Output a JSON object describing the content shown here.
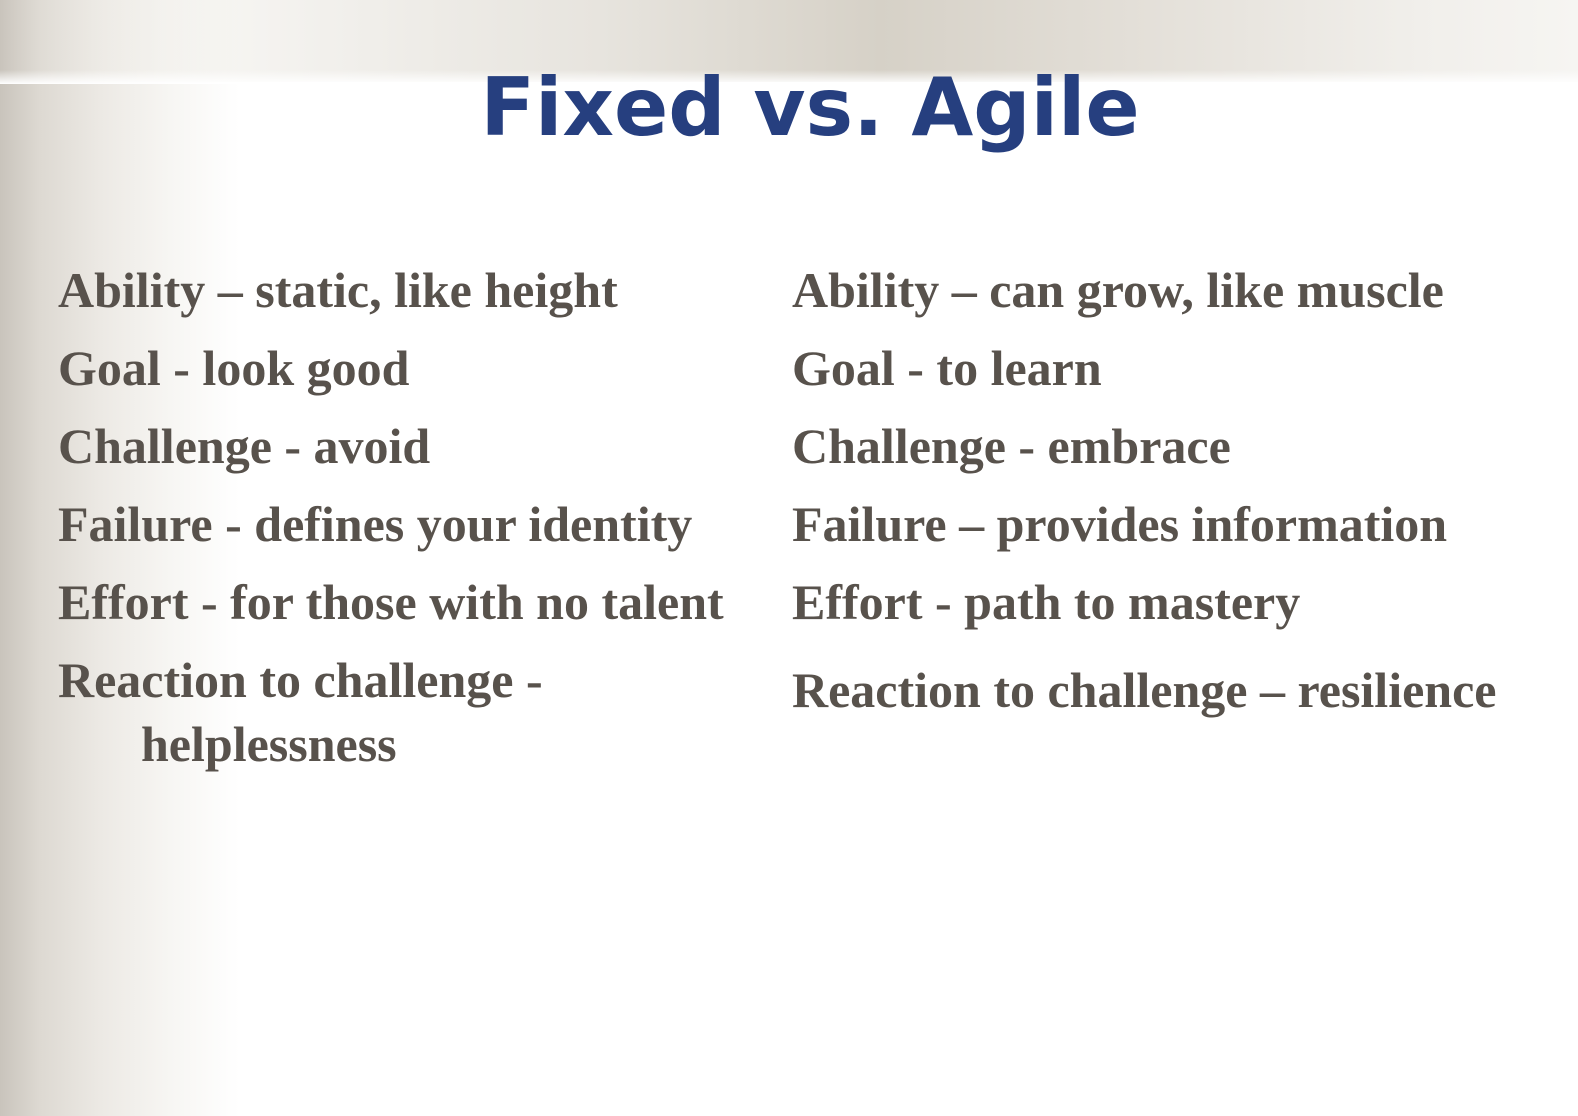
{
  "slide": {
    "title": "Fixed vs. Agile",
    "colors": {
      "title": "#263f7f",
      "body_text": "#58524c",
      "background": "#ffffff"
    },
    "left_column": [
      "Ability – static, like height",
      "Goal - look good",
      "Challenge - avoid",
      "Failure - defines your identity",
      "Effort - for those with no talent",
      "Reaction to challenge - helplessness"
    ],
    "right_column": [
      "Ability – can grow, like muscle",
      "Goal - to learn",
      "Challenge - embrace",
      "Failure – provides information",
      "Effort - path to mastery",
      "Reaction to challenge – resilience"
    ]
  }
}
